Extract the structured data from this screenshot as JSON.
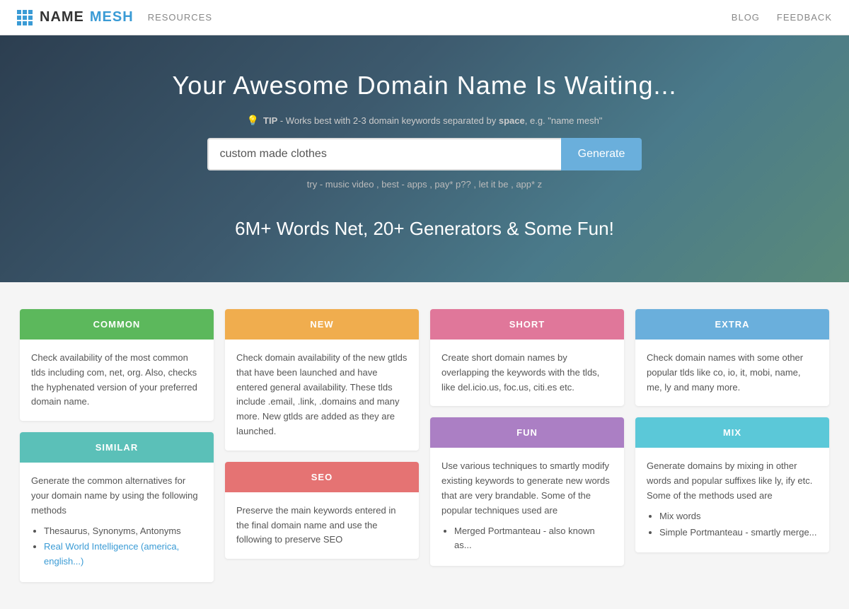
{
  "header": {
    "logo_name": "NAME",
    "logo_mesh": "MESH",
    "nav_resources": "RESOURCES",
    "nav_blog": "BLOG",
    "nav_feedback": "FEEDBACK"
  },
  "hero": {
    "headline": "Your Awesome Domain Name Is Waiting...",
    "tip_label": "TIP",
    "tip_text": " - Works best with 2-3 domain keywords separated by ",
    "tip_bold": "space",
    "tip_example": ", e.g. \"name mesh\"",
    "search_value": "custom made clothes",
    "search_placeholder": "custom made clothes",
    "generate_label": "Generate",
    "try_prefix": "try - ",
    "try_links": "music video , best - apps , pay* p?? , let it be , app* z",
    "subheadline": "6M+ Words Net, 20+ Generators & Some Fun!"
  },
  "cards": [
    {
      "id": "common",
      "label": "COMMON",
      "color": "color-green",
      "body": "Check availability of the most common tlds including com, net, org. Also, checks the hyphenated version of your preferred domain name."
    },
    {
      "id": "new",
      "label": "NEW",
      "color": "color-yellow",
      "body": "Check domain availability of the new gtlds that have been launched and have entered general availability. These tlds include .email, .link, .domains and many more. New gtlds are added as they are launched."
    },
    {
      "id": "short",
      "label": "SHORT",
      "color": "color-pink",
      "body": "Create short domain names by overlapping the keywords with the tlds, like del.icio.us, foc.us, citi.es etc."
    },
    {
      "id": "extra",
      "label": "EXTRA",
      "color": "color-blue",
      "body": "Check domain names with some other popular tlds like co, io, it, mobi, name, me, ly and many more."
    },
    {
      "id": "similar",
      "label": "SIMILAR",
      "color": "color-teal",
      "header_body": "Generate the common alternatives for your domain name by using the following methods",
      "bullets": [
        "Thesaurus, Synonyms, Antonyms",
        "Real World Intelligence (america, english...)"
      ]
    },
    {
      "id": "seo",
      "label": "SEO",
      "color": "color-red",
      "body": "Preserve the main keywords entered in the final domain name and use the following to preserve SEO"
    },
    {
      "id": "fun",
      "label": "FUN",
      "color": "color-purple",
      "body": "Use various techniques to smartly modify existing keywords to generate new words that are very brandable. Some of the popular techniques used are",
      "bullets_fun": [
        "Merged Portmanteau - also known as..."
      ]
    },
    {
      "id": "mix",
      "label": "MIX",
      "color": "color-cyan",
      "body": "Generate domains by mixing in other words and popular suffixes like ly, ify etc. Some of the methods used are",
      "bullets_mix": [
        "Mix words",
        "Simple Portmanteau - smartly merge..."
      ]
    }
  ]
}
